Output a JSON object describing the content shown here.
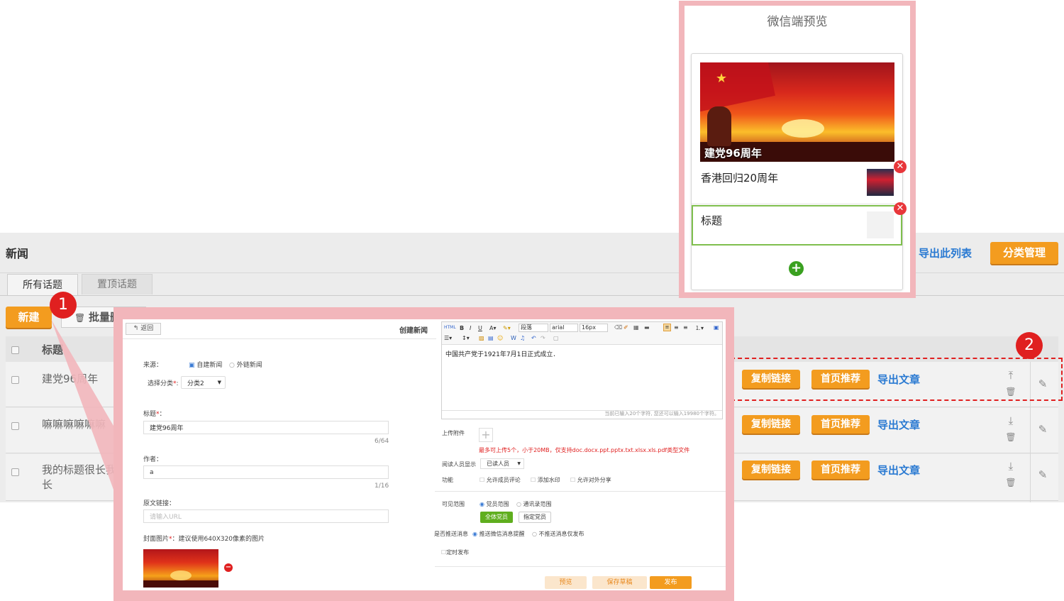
{
  "bg": {
    "title": "新闻",
    "export_list": "导出此列表",
    "category_mgmt": "分类管理",
    "tabs": [
      "所有话题",
      "置顶话题"
    ],
    "new_btn": "新建",
    "batch_btn": "批量删除",
    "col_title": "标题",
    "rows": [
      {
        "title": "建党96周年",
        "title_line2": ""
      },
      {
        "title": "嘛嘛嘛嘛嘛嘛",
        "title_line2": ""
      },
      {
        "title": "我的标题很长我的标题很",
        "title_line2": "长"
      }
    ],
    "row_actions": {
      "copy": "复制链接",
      "recommend": "首页推荐",
      "export": "导出文章"
    }
  },
  "preview": {
    "title": "微信端预览",
    "cover_caption": "建党96周年",
    "item1": "香港回归20周年",
    "item2": "标题"
  },
  "form": {
    "back": "返回",
    "header": "创建新闻",
    "source_label": "来源：",
    "source_opt1": "自建新闻",
    "source_opt2": "外链新闻",
    "category_label": "选择分类",
    "category_required": "*",
    "category_value": "分类2",
    "title_label": "标题",
    "title_value": "建党96周年",
    "title_count": "6/64",
    "author_label": "作者：",
    "author_value": "a",
    "author_count": "1/16",
    "link_label": "原文链接：",
    "link_placeholder": "请输入URL",
    "cover_label": "封面图片",
    "cover_hint": "：建议使用640X320像素的图片",
    "editor": {
      "para": "段落",
      "font": "arial",
      "size": "16px",
      "content": "中国共产党于1921年7月1日正式成立．",
      "counter": "当前已输入20个字符, 您还可以输入19980个字符。"
    },
    "attach_label": "上传附件",
    "attach_hint": "最多可上传5个，小于20MB，仅支持doc.docx.ppt.pptx.txt.xlsx.xls.pdf类型文件",
    "reader_label": "阅读人员显示",
    "reader_value": "已读人员",
    "func_label": "功能",
    "func_opts": [
      "允许成员评论",
      "添加水印",
      "允许对外分享"
    ],
    "scope_label": "可见范围",
    "scope_opt1": "党员范围",
    "scope_opt2": "通讯录范围",
    "scope_btn1": "全体党员",
    "scope_btn2": "指定党员",
    "push_label": "是否推送消息",
    "push_opt1": "推送微信消息提醒",
    "push_opt2": "不推送消息仅发布",
    "timed": "定时发布",
    "btn_preview": "预览",
    "btn_draft": "保存草稿",
    "btn_publish": "发布"
  },
  "badges": [
    "1",
    "2"
  ],
  "colors": {
    "orange": "#f39c1f",
    "pink_frame": "#f2b6bb",
    "link": "#2a7ad2",
    "red": "#e02020",
    "green": "#5fae1e"
  }
}
